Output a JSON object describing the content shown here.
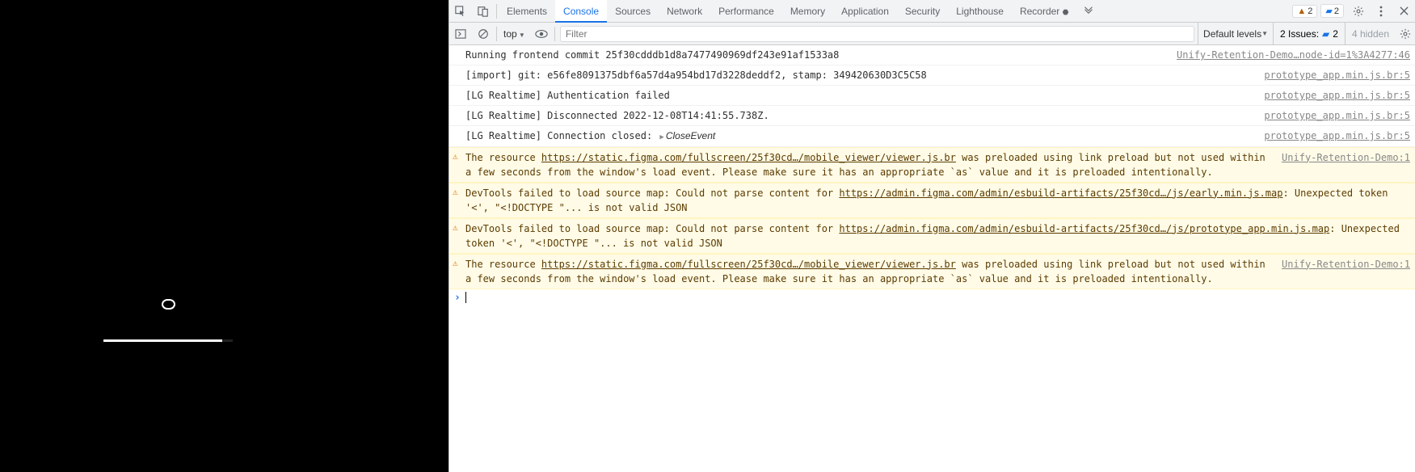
{
  "tabs": {
    "elements": "Elements",
    "console": "Console",
    "sources": "Sources",
    "network": "Network",
    "performance": "Performance",
    "memory": "Memory",
    "application": "Application",
    "security": "Security",
    "lighthouse": "Lighthouse",
    "recorder": "Recorder"
  },
  "badges": {
    "warn_count": "2",
    "info_count": "2"
  },
  "toolbar": {
    "context": "top",
    "filter_placeholder": "Filter",
    "levels": "Default levels",
    "issues_label": "2 Issues:",
    "issues_count": "2",
    "hidden": "4 hidden"
  },
  "logs": [
    {
      "type": "log",
      "msg": "Running frontend commit 25f30cdddb1d8a7477490969df243e91af1533a8",
      "src": "Unify-Retention-Demo…node-id=1%3A4277:46"
    },
    {
      "type": "log",
      "msg": "[import] git: e56fe8091375dbf6a57d4a954bd17d3228deddf2, stamp: 349420630D3C5C58",
      "src": "prototype_app.min.js.br:5"
    },
    {
      "type": "log",
      "msg": "[LG Realtime] Authentication failed",
      "src": "prototype_app.min.js.br:5"
    },
    {
      "type": "log",
      "msg": "[LG Realtime] Disconnected 2022-12-08T14:41:55.738Z.",
      "src": "prototype_app.min.js.br:5"
    },
    {
      "type": "expand",
      "msg_pre": "[LG Realtime] Connection closed: ",
      "event": "CloseEvent",
      "src": "prototype_app.min.js.br:5"
    },
    {
      "type": "warn",
      "msg_pre": "The resource ",
      "link": "https://static.figma.com/fullscreen/25f30cd…/mobile_viewer/viewer.js.br",
      "msg_post": " was preloaded using link preload but not used within a few seconds from the window's load event. Please make sure it has an appropriate `as` value and it is preloaded intentionally.",
      "src": "Unify-Retention-Demo:1"
    },
    {
      "type": "warn",
      "msg_pre": "DevTools failed to load source map: Could not parse content for ",
      "link": "https://admin.figma.com/admin/esbuild-artifacts/25f30cd…/js/early.min.js.map",
      "msg_post": ": Unexpected token '<', \"<!DOCTYPE \"... is not valid JSON",
      "src": ""
    },
    {
      "type": "warn",
      "msg_pre": "DevTools failed to load source map: Could not parse content for ",
      "link": "https://admin.figma.com/admin/esbuild-artifacts/25f30cd…/js/prototype_app.min.js.map",
      "msg_post": ": Unexpected token '<', \"<!DOCTYPE \"... is not valid JSON",
      "src": ""
    },
    {
      "type": "warn",
      "msg_pre": "The resource ",
      "link": "https://static.figma.com/fullscreen/25f30cd…/mobile_viewer/viewer.js.br",
      "msg_post": " was preloaded using link preload but not used within a few seconds from the window's load event. Please make sure it has an appropriate `as` value and it is preloaded intentionally.",
      "src": "Unify-Retention-Demo:1"
    }
  ]
}
